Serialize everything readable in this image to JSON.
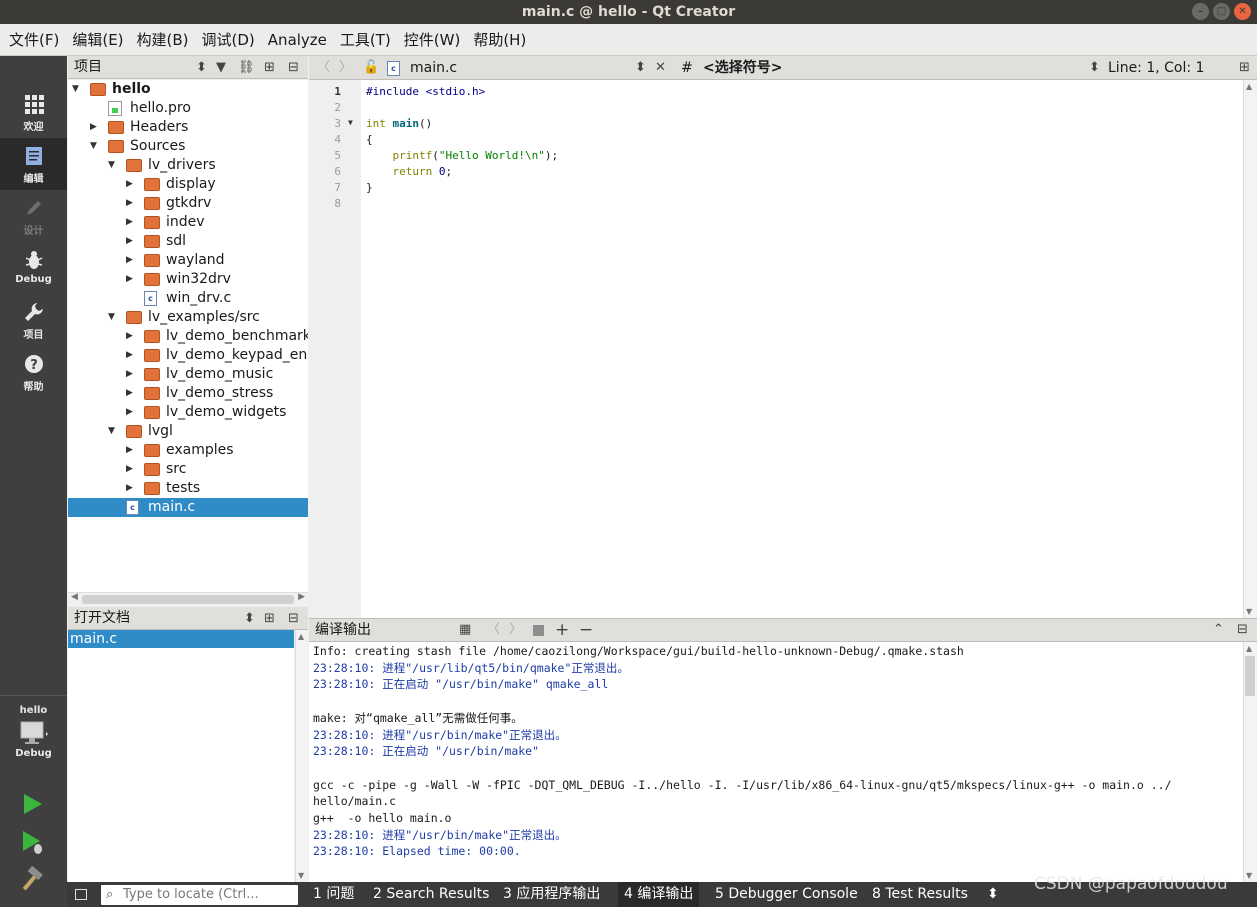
{
  "window": {
    "title": "main.c @ hello - Qt Creator"
  },
  "menu": [
    "文件(F)",
    "编辑(E)",
    "构建(B)",
    "调试(D)",
    "Analyze",
    "工具(T)",
    "控件(W)",
    "帮助(H)"
  ],
  "modes": {
    "welcome": "欢迎",
    "edit": "编辑",
    "design": "设计",
    "debug": "Debug",
    "projects": "项目",
    "help": "帮助"
  },
  "kit": {
    "project": "hello",
    "config": "Debug"
  },
  "projects_pane": {
    "title": "项目"
  },
  "tree": [
    {
      "label": "hello",
      "depth": 0,
      "kind": "project",
      "expanded": true,
      "bold": true
    },
    {
      "label": "hello.pro",
      "depth": 1,
      "kind": "pro"
    },
    {
      "label": "Headers",
      "depth": 1,
      "kind": "hfolder",
      "collapsed": true
    },
    {
      "label": "Sources",
      "depth": 1,
      "kind": "cfolder",
      "expanded": true
    },
    {
      "label": "lv_drivers",
      "depth": 2,
      "kind": "folder",
      "expanded": true
    },
    {
      "label": "display",
      "depth": 3,
      "kind": "folder",
      "collapsed": true
    },
    {
      "label": "gtkdrv",
      "depth": 3,
      "kind": "folder",
      "collapsed": true
    },
    {
      "label": "indev",
      "depth": 3,
      "kind": "folder",
      "collapsed": true
    },
    {
      "label": "sdl",
      "depth": 3,
      "kind": "folder",
      "collapsed": true
    },
    {
      "label": "wayland",
      "depth": 3,
      "kind": "folder",
      "collapsed": true
    },
    {
      "label": "win32drv",
      "depth": 3,
      "kind": "folder",
      "collapsed": true
    },
    {
      "label": "win_drv.c",
      "depth": 3,
      "kind": "file"
    },
    {
      "label": "lv_examples/src",
      "depth": 2,
      "kind": "folder",
      "expanded": true
    },
    {
      "label": "lv_demo_benchmark",
      "depth": 3,
      "kind": "folder",
      "collapsed": true
    },
    {
      "label": "lv_demo_keypad_enc",
      "depth": 3,
      "kind": "folder",
      "collapsed": true
    },
    {
      "label": "lv_demo_music",
      "depth": 3,
      "kind": "folder",
      "collapsed": true
    },
    {
      "label": "lv_demo_stress",
      "depth": 3,
      "kind": "folder",
      "collapsed": true
    },
    {
      "label": "lv_demo_widgets",
      "depth": 3,
      "kind": "folder",
      "collapsed": true
    },
    {
      "label": "lvgl",
      "depth": 2,
      "kind": "folder",
      "expanded": true
    },
    {
      "label": "examples",
      "depth": 3,
      "kind": "folder",
      "collapsed": true
    },
    {
      "label": "src",
      "depth": 3,
      "kind": "folder",
      "collapsed": true
    },
    {
      "label": "tests",
      "depth": 3,
      "kind": "folder",
      "collapsed": true
    },
    {
      "label": "main.c",
      "depth": 2,
      "kind": "file",
      "selected": true
    }
  ],
  "open_docs": {
    "title": "打开文档",
    "items": [
      "main.c"
    ]
  },
  "editor": {
    "file": "main.c",
    "symbol": "<选择符号>",
    "hash": "#",
    "position": "Line: 1, Col: 1",
    "line_numbers": [
      "1",
      "2",
      "3",
      "4",
      "5",
      "6",
      "7",
      "8"
    ],
    "lines": [
      "#include <stdio.h>",
      "",
      "int main()",
      "{",
      "    printf(\"Hello World!\\n\");",
      "    return 0;",
      "}",
      ""
    ]
  },
  "output": {
    "title": "编译输出",
    "lines": [
      {
        "text": "Info: creating stash file /home/caozilong/Workspace/gui/build-hello-unknown-Debug/.qmake.stash",
        "color": "black"
      },
      {
        "text": "23:28:10: 进程\"/usr/lib/qt5/bin/qmake\"正常退出。",
        "color": "blue"
      },
      {
        "text": "23:28:10: 正在启动 \"/usr/bin/make\" qmake_all",
        "color": "blue"
      },
      {
        "text": "",
        "color": "black"
      },
      {
        "text": "make: 对“qmake_all”无需做任何事。",
        "color": "black"
      },
      {
        "text": "23:28:10: 进程\"/usr/bin/make\"正常退出。",
        "color": "blue"
      },
      {
        "text": "23:28:10: 正在启动 \"/usr/bin/make\"",
        "color": "blue"
      },
      {
        "text": "",
        "color": "black"
      },
      {
        "text": "gcc -c -pipe -g -Wall -W -fPIC -DQT_QML_DEBUG -I../hello -I. -I/usr/lib/x86_64-linux-gnu/qt5/mkspecs/linux-g++ -o main.o ../",
        "color": "black"
      },
      {
        "text": "hello/main.c",
        "color": "black"
      },
      {
        "text": "g++  -o hello main.o",
        "color": "black"
      },
      {
        "text": "23:28:10: 进程\"/usr/bin/make\"正常退出。",
        "color": "blue"
      },
      {
        "text": "23:28:10: Elapsed time: 00:00.",
        "color": "blue"
      }
    ]
  },
  "statusbar": {
    "locator_placeholder": "Type to locate (Ctrl...",
    "tabs": [
      "1 问题",
      "2 Search Results",
      "3 应用程序输出",
      "4 编译输出",
      "5 Debugger Console",
      "8 Test Results"
    ],
    "active_tab": 3
  },
  "watermark": "CSDN @papaofdoudou",
  "colors": {
    "selection": "#308cc6",
    "folder": "#e0723a",
    "modebar": "#3f3f3f",
    "title_bg": "#3b3a36"
  }
}
